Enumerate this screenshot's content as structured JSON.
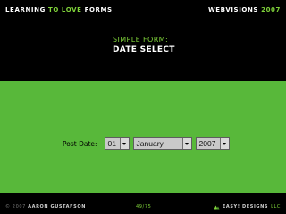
{
  "header": {
    "left_1": "LEARNING",
    "left_2": "TO LOVE",
    "left_3": "FORMS",
    "right_1": "WEBVISIONS",
    "right_2": "2007"
  },
  "slide": {
    "subtitle": "SIMPLE FORM:",
    "title": "DATE SELECT"
  },
  "form": {
    "post_date_label": "Post Date:",
    "day_value": "01",
    "month_value": "January",
    "year_value": "2007"
  },
  "footer": {
    "copyright": "© 2007",
    "author": "AARON GUSTAFSON",
    "slide_number": "49/75",
    "brand": "EASY! DESIGNS",
    "brand_suffix": "LLC"
  },
  "colors": {
    "accent": "#7fd23a",
    "panel": "#58b83a",
    "background": "#000000"
  }
}
